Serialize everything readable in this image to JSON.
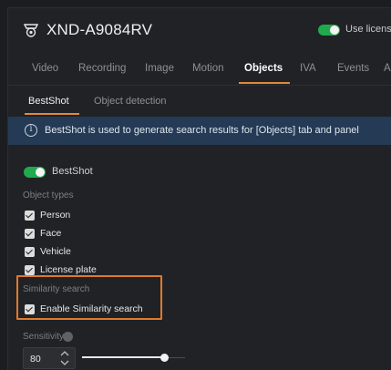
{
  "header": {
    "device_name": "XND-A9084RV",
    "license_label": "Use license"
  },
  "tabs": [
    {
      "label": "Video",
      "active": false
    },
    {
      "label": "Recording",
      "active": false
    },
    {
      "label": "Image",
      "active": false
    },
    {
      "label": "Motion",
      "active": false
    },
    {
      "label": "Objects",
      "active": true
    },
    {
      "label": "IVA",
      "active": false
    },
    {
      "label": "Events",
      "active": false
    },
    {
      "label": "A",
      "active": false
    }
  ],
  "subtabs": [
    {
      "label": "BestShot",
      "active": true
    },
    {
      "label": "Object detection",
      "active": false
    }
  ],
  "info_banner": {
    "text": "BestShot is used to generate search results for [Objects] tab and panel"
  },
  "bestshot": {
    "label": "BestShot",
    "enabled": true
  },
  "object_types": {
    "label": "Object types",
    "items": [
      {
        "label": "Person",
        "checked": true
      },
      {
        "label": "Face",
        "checked": true
      },
      {
        "label": "Vehicle",
        "checked": true
      },
      {
        "label": "License plate",
        "checked": true
      }
    ]
  },
  "similarity": {
    "label": "Similarity search",
    "checkbox_label": "Enable Similarity search",
    "checked": true
  },
  "sensitivity": {
    "label": "Sensitivity",
    "value": "80",
    "fraction": 0.8
  },
  "colors": {
    "accent": "#e08a3c",
    "toggle_on": "#1faa4e",
    "banner": "#243a55",
    "highlight": "#e07a2c"
  }
}
